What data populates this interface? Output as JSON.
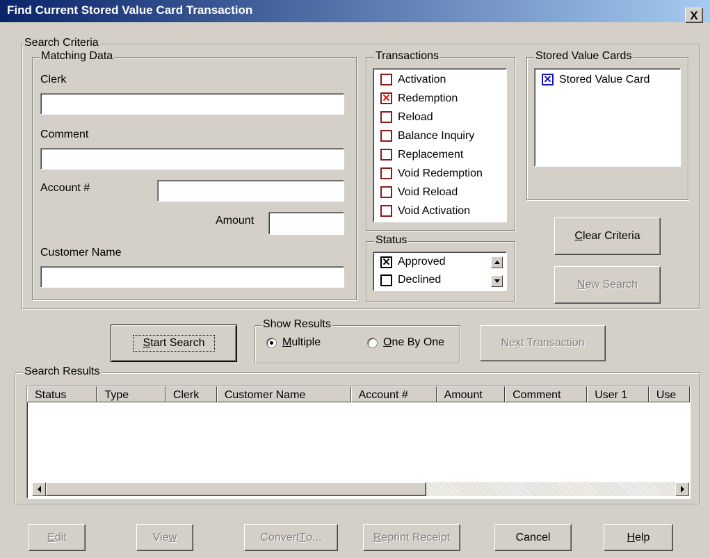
{
  "window": {
    "title": "Find Current Stored Value Card Transaction",
    "close_glyph": "X"
  },
  "search_criteria": {
    "label": "Search Criteria",
    "matching_data": {
      "label": "Matching Data",
      "clerk_label": "Clerk",
      "clerk_value": "",
      "comment_label": "Comment",
      "comment_value": "",
      "account_label": "Account #",
      "account_value": "",
      "amount_label": "Amount",
      "amount_value": "",
      "customer_label": "Customer Name",
      "customer_value": ""
    },
    "transactions": {
      "label": "Transactions",
      "items": [
        {
          "label": "Activation",
          "checked": false
        },
        {
          "label": "Redemption",
          "checked": true
        },
        {
          "label": "Reload",
          "checked": false
        },
        {
          "label": "Balance Inquiry",
          "checked": false
        },
        {
          "label": "Replacement",
          "checked": false
        },
        {
          "label": "Void Redemption",
          "checked": false
        },
        {
          "label": "Void Reload",
          "checked": false
        },
        {
          "label": "Void Activation",
          "checked": false
        }
      ]
    },
    "stored_value_cards": {
      "label": "Stored Value Cards",
      "items": [
        {
          "label": "Stored Value Card",
          "checked": true
        }
      ]
    },
    "status": {
      "label": "Status",
      "items": [
        {
          "label": "Approved",
          "checked": true
        },
        {
          "label": "Declined",
          "checked": false
        }
      ]
    },
    "clear_criteria": {
      "pre": "",
      "key": "C",
      "post": "lear Criteria"
    },
    "new_search": {
      "pre": "",
      "key": "N",
      "post": "ew Search"
    }
  },
  "start_search": {
    "pre": "",
    "key": "S",
    "post": "tart Search"
  },
  "show_results": {
    "label": "Show Results",
    "options": [
      {
        "pre": "",
        "key": "M",
        "post": "ultiple",
        "selected": true
      },
      {
        "pre": "",
        "key": "O",
        "post": "ne By One",
        "selected": false
      }
    ]
  },
  "next_transaction": {
    "pre": "Ne",
    "key": "x",
    "post": "t Transaction"
  },
  "search_results": {
    "label": "Search Results",
    "columns": [
      "Status",
      "Type",
      "Clerk",
      "Customer Name",
      "Account #",
      "Amount",
      "Comment",
      "User 1",
      "Use"
    ],
    "rows": []
  },
  "bottom_buttons": {
    "edit": {
      "pre": "",
      "key": "E",
      "post": "dit"
    },
    "view": {
      "pre": "Vie",
      "key": "w",
      "post": ""
    },
    "convert": {
      "pre": "Convert ",
      "key": "T",
      "post": "o..."
    },
    "reprint": {
      "pre": "",
      "key": "R",
      "post": "eprint Receipt"
    },
    "cancel": {
      "label": "Cancel"
    },
    "help": {
      "pre": "",
      "key": "H",
      "post": "elp"
    }
  },
  "colors": {
    "title_start": "#0a246a",
    "title_end": "#a6caf0",
    "face": "#d4d0c8",
    "check_red": "#e01010",
    "check_blue": "#1515c0"
  }
}
